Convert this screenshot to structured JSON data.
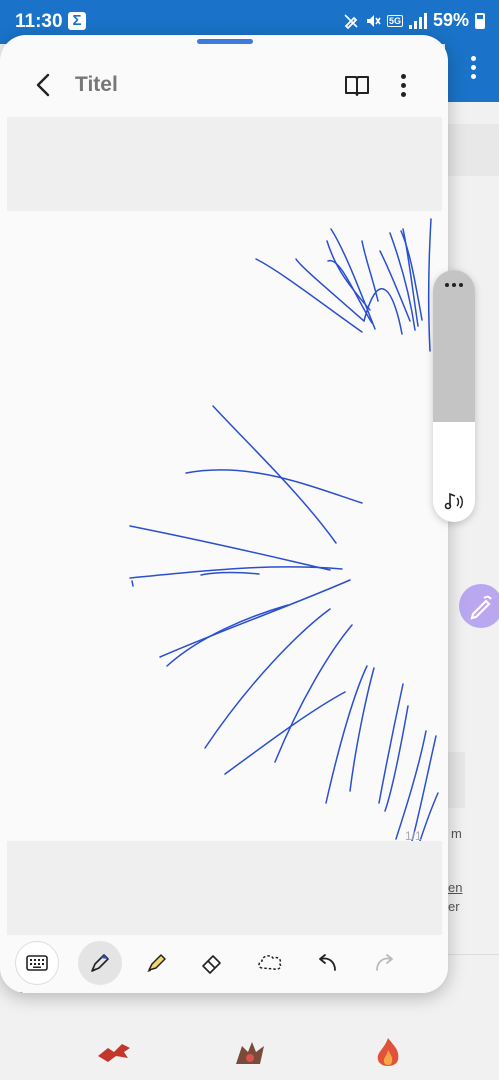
{
  "status_bar": {
    "time": "11:30",
    "network": "5G",
    "battery": "59%"
  },
  "note": {
    "title": "Titel",
    "page_indicator": "1/1"
  },
  "background_app": {
    "fragment_1": "m",
    "fragment_2": "en",
    "fragment_3": "er",
    "answer_label": "Antworten"
  },
  "toolbar": {
    "tools": [
      "keyboard",
      "pen",
      "highlighter",
      "eraser",
      "lasso",
      "undo",
      "redo"
    ]
  },
  "colors": {
    "accent": "#1a73c8",
    "ink": "#2a4fcf",
    "fab": "#b9a8f0"
  }
}
